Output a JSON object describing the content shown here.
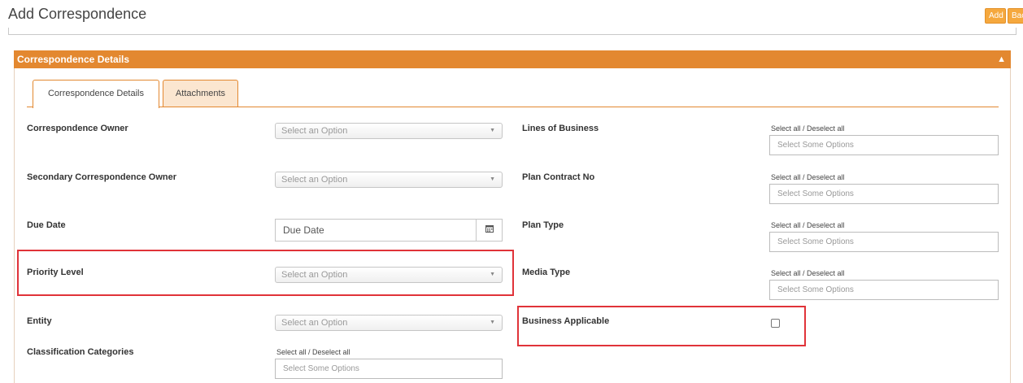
{
  "header": {
    "title": "Add Correspondence",
    "add_label": "Add",
    "back_label": "Back"
  },
  "panel": {
    "title": "Correspondence Details",
    "collapse_icon": "chevron-up-icon"
  },
  "tabs": [
    {
      "label": "Correspondence Details",
      "active": true
    },
    {
      "label": "Attachments",
      "active": false
    }
  ],
  "left": {
    "owner": {
      "label": "Correspondence Owner",
      "value": "Select an Option"
    },
    "secondary_owner": {
      "label": "Secondary Correspondence Owner",
      "value": "Select an Option"
    },
    "due_date": {
      "label": "Due Date",
      "placeholder": "Due Date",
      "icon": "calendar-icon"
    },
    "priority": {
      "label": "Priority Level",
      "value": "Select an Option"
    },
    "entity": {
      "label": "Entity",
      "value": "Select an Option"
    },
    "classification": {
      "label": "Classification Categories",
      "select_all": "Select all / Deselect all",
      "placeholder": "Select Some Options"
    }
  },
  "right": {
    "lines_of_business": {
      "label": "Lines of Business",
      "select_all": "Select all / Deselect all",
      "placeholder": "Select Some Options"
    },
    "plan_contract": {
      "label": "Plan Contract No",
      "select_all": "Select all / Deselect all",
      "placeholder": "Select Some Options"
    },
    "plan_type": {
      "label": "Plan Type",
      "select_all": "Select all / Deselect all",
      "placeholder": "Select Some Options"
    },
    "media_type": {
      "label": "Media Type",
      "select_all": "Select all / Deselect all",
      "placeholder": "Select Some Options"
    },
    "business_applicable": {
      "label": "Business Applicable",
      "checked": false
    }
  },
  "colors": {
    "accent": "#e38830",
    "button": "#f5a83e",
    "highlight": "#e03339"
  }
}
